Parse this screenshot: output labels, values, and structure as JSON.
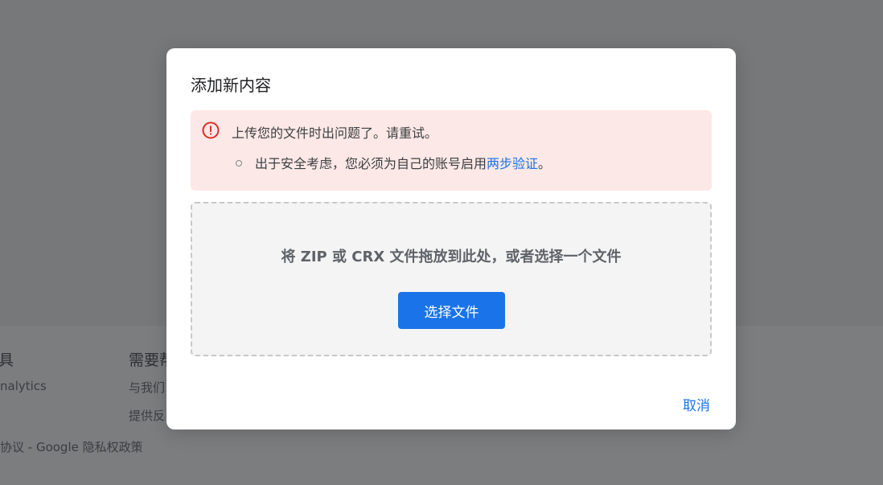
{
  "background": {
    "footer": {
      "col1_heading": "具",
      "col1_link1": "nalytics",
      "col2_heading": "需要帮",
      "col2_link1": "与我们",
      "col2_link2": "提供反",
      "legal": "协议 - Google 隐私权政策"
    }
  },
  "dialog": {
    "title": "添加新内容",
    "error": {
      "icon": "error-circle-icon",
      "message": "上传您的文件时出问题了。请重试。",
      "detail_prefix": "出于安全考虑，您必须为自己的账号启用",
      "detail_link": "两步验证",
      "detail_suffix": "。"
    },
    "dropzone": {
      "text": "将 ZIP 或 CRX 文件拖放到此处，或者选择一个文件",
      "button_label": "选择文件"
    },
    "cancel_label": "取消"
  },
  "colors": {
    "accent": "#1a73e8",
    "error_bg": "#fce8e6",
    "error_icon": "#d93025",
    "overlay": "#77787a"
  }
}
